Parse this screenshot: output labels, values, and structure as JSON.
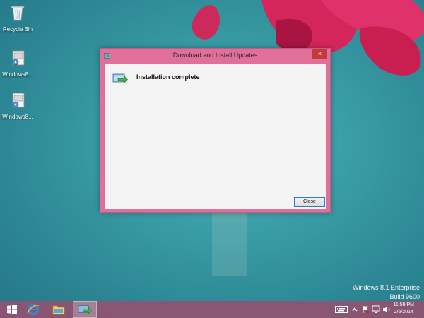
{
  "desktop": {
    "icons": [
      {
        "label": "Recycle Bin",
        "icon": "recycle-bin-icon"
      },
      {
        "label": "Windows8...",
        "icon": "installer-icon"
      },
      {
        "label": "Windows8...",
        "icon": "installer-icon"
      }
    ],
    "branding": {
      "edition": "Windows 8.1 Enterprise",
      "build": "Build 9600"
    }
  },
  "window": {
    "title": "Download and Install Updates",
    "close_label": "×",
    "status_text": "Installation complete",
    "status_icon": "update-arrow-icon",
    "close_button_label": "Close"
  },
  "taskbar": {
    "buttons": [
      {
        "icon": "windows-start-icon"
      },
      {
        "icon": "internet-explorer-icon"
      },
      {
        "icon": "file-explorer-icon"
      },
      {
        "icon": "update-installer-icon",
        "active": true
      }
    ],
    "tray": {
      "icons": [
        "keyboard-icon",
        "show-hidden-icons-icon",
        "action-center-flag-icon",
        "network-icon",
        "volume-icon"
      ],
      "time": "11:59 PM",
      "date": "2/6/2014"
    }
  },
  "colors": {
    "window_frame": "#e0709a",
    "close_button": "#c23b3b",
    "desktop_teal": "#3a9ea6",
    "taskbar": "#965070"
  }
}
